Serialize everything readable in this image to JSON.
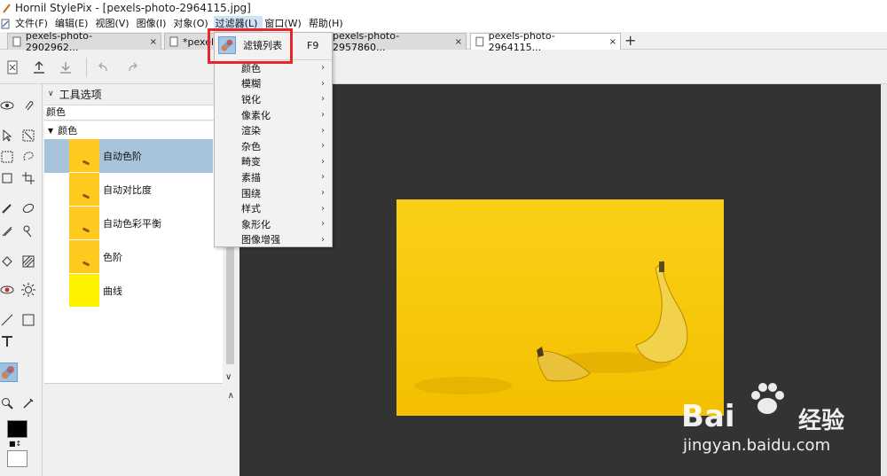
{
  "window": {
    "title": "Hornil StylePix - [pexels-photo-2964115.jpg]"
  },
  "menubar": {
    "items": [
      "文件(F)",
      "编辑(E)",
      "视图(V)",
      "图像(I)",
      "对象(O)",
      "过滤器(L)",
      "窗口(W)",
      "帮助(H)"
    ]
  },
  "tabs": [
    {
      "label": "pexels-photo-2902962...",
      "close": "×"
    },
    {
      "label": "*pexels-photo-2902962...",
      "close": "×"
    },
    {
      "label": "pexels-photo-2957860...",
      "close": "×"
    },
    {
      "label": "pexels-photo-2964115...",
      "close": "×"
    }
  ],
  "toolbar": {
    "icons": [
      "new-document-icon",
      "export-icon",
      "import-icon",
      "undo-icon",
      "redo-icon"
    ]
  },
  "tool_options": {
    "header": "工具选项",
    "subheader": "颜色",
    "category": "颜色",
    "filters": [
      {
        "label": "自动色阶"
      },
      {
        "label": "自动对比度"
      },
      {
        "label": "自动色彩平衡"
      },
      {
        "label": "色阶"
      },
      {
        "label": "曲线"
      }
    ],
    "selected_index": 0
  },
  "filter_menu": {
    "top_item": {
      "label": "滤镜列表",
      "shortcut": "F9"
    },
    "items": [
      "颜色",
      "模糊",
      "锐化",
      "像素化",
      "渲染",
      "杂色",
      "畸变",
      "素描",
      "围绕",
      "样式",
      "象形化",
      "图像增强"
    ]
  },
  "colors": {
    "foreground": "#000000",
    "background": "#ffffff",
    "canvas_bg": "#333333",
    "photo_yellow": "#f6c400",
    "highlight": "#e8262a"
  },
  "watermark": {
    "brand": "Bai",
    "brand_cn": "经验",
    "url": "jingyan.baidu.com"
  }
}
